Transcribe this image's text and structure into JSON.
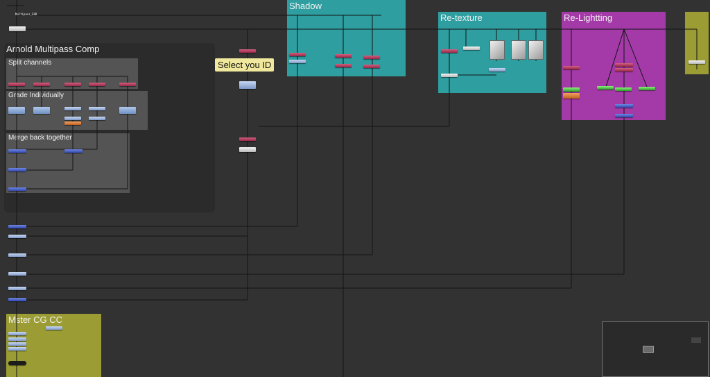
{
  "graph": {
    "top_left_node_label": "Multipass_EXR",
    "backdrops": {
      "arnold_comp": "Arnold Multipass Comp",
      "split_channels": "Split channels",
      "grade_individually": "Grade Individually",
      "merge_back": "Merge back together",
      "shadow": "Shadow",
      "retexture": "Re-texture",
      "relighting": "Re-Lightting",
      "master_cc": "Mster CG CC"
    },
    "sticky_note": "Select you ID"
  },
  "colors": {
    "canvas": "#323232",
    "shadow_backdrop": "#2e9ea0",
    "retexture_backdrop": "#2e9ea0",
    "relighting_backdrop": "#a43aa8",
    "master_cc_backdrop": "#9c9c34",
    "olive_backdrop": "#9c9c34",
    "sticky": "#f0e89c"
  }
}
